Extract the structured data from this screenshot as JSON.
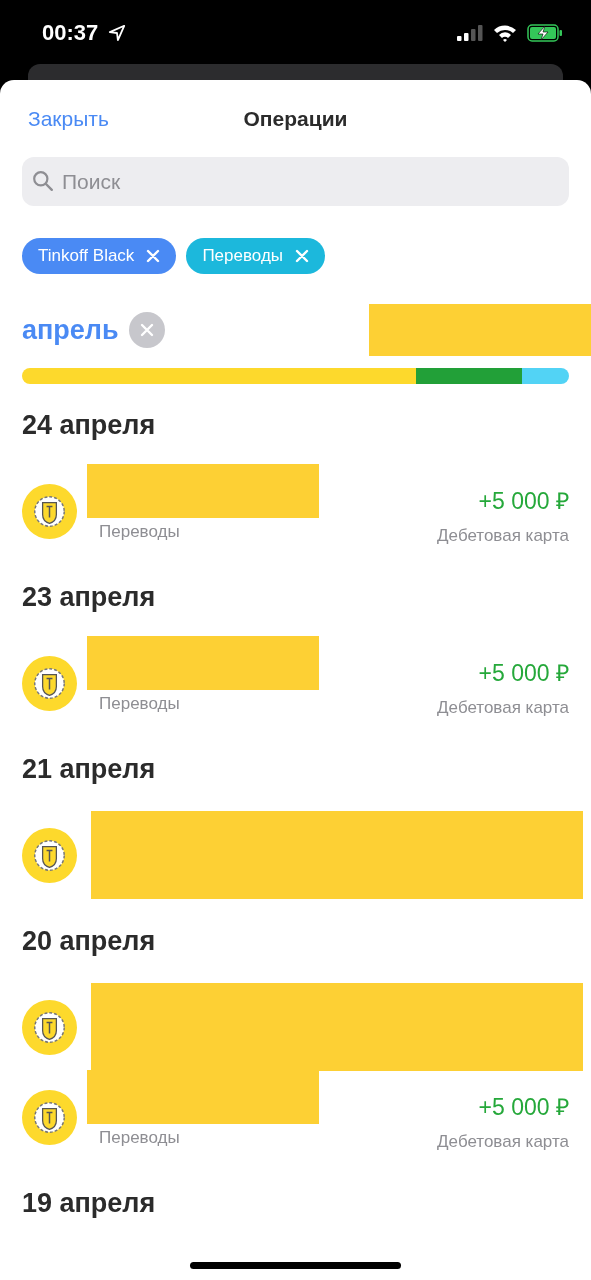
{
  "status_bar": {
    "time": "00:37"
  },
  "header": {
    "close": "Закрыть",
    "title": "Операции"
  },
  "search": {
    "placeholder": "Поиск"
  },
  "filters": [
    {
      "label": "Tinkoff Black",
      "color": "#4a8af4"
    },
    {
      "label": "Переводы",
      "color": "#1cb8dc"
    }
  ],
  "period": {
    "label": "апрель",
    "total_redacted": true
  },
  "spending_bar": [
    {
      "color": "#fdd92c"
    },
    {
      "color": "#fdd92c"
    },
    {
      "color": "#22a038"
    },
    {
      "color": "#22a038"
    },
    {
      "color": "#52d3f5"
    }
  ],
  "days": [
    {
      "date": "24 апреля",
      "operations": [
        {
          "kind": "partial",
          "category": "Переводы",
          "amount": "+5 000 ₽",
          "account": "Дебетовая карта"
        }
      ]
    },
    {
      "date": "23 апреля",
      "operations": [
        {
          "kind": "partial",
          "category": "Переводы",
          "amount": "+5 000 ₽",
          "account": "Дебетовая карта"
        }
      ]
    },
    {
      "date": "21 апреля",
      "operations": [
        {
          "kind": "redacted"
        }
      ]
    },
    {
      "date": "20 апреля",
      "operations": [
        {
          "kind": "redacted"
        },
        {
          "kind": "partial",
          "category": "Переводы",
          "amount": "+5 000 ₽",
          "account": "Дебетовая карта"
        }
      ]
    },
    {
      "date": "19 апреля"
    }
  ]
}
